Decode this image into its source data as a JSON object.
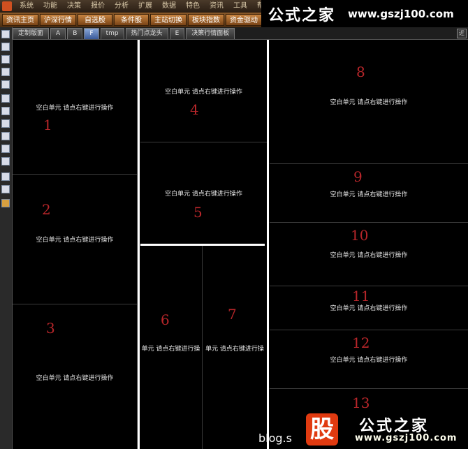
{
  "menubar": {
    "items": [
      "系统",
      "功能",
      "决策",
      "报价",
      "分析",
      "扩展",
      "数据",
      "特色",
      "资讯",
      "工具",
      "帮"
    ]
  },
  "toolbar": {
    "buttons": [
      "资讯主页",
      "沪深行情",
      "自选股",
      "条件股",
      "主站切换",
      "板块指数",
      "资金驱动",
      "资金"
    ]
  },
  "brand": {
    "name": "公式之家",
    "url": "www.gszj100.com"
  },
  "tabs": [
    "定制版面",
    "A",
    "B",
    "F",
    "tmp",
    "热门点龙头",
    "E",
    "决策行情面板"
  ],
  "active_tab": "F",
  "tab_corner": "近",
  "blank_cell_text": "空白单元 请点右键进行操作",
  "cells": [
    {
      "number": "1",
      "text": "空白单元 请点右键进行操作"
    },
    {
      "number": "2",
      "text": "空白单元 请点右键进行操作"
    },
    {
      "number": "3",
      "text": "空白单元 请点右键进行操作"
    },
    {
      "number": "4",
      "text": "空白单元 请点右键进行操作"
    },
    {
      "number": "5",
      "text": "空白单元 请点右键进行操作"
    },
    {
      "number": "6",
      "text": "单元 请点右键进行操"
    },
    {
      "number": "7",
      "text": "单元 请点右键进行操"
    },
    {
      "number": "8",
      "text": "空白单元 请点右键进行操作"
    },
    {
      "number": "9",
      "text": "空白单元 请点右键进行操作"
    },
    {
      "number": "10",
      "text": "空白单元 请点右键进行操作"
    },
    {
      "number": "11",
      "text": "空白单元 请点右键进行操作"
    },
    {
      "number": "12",
      "text": "空白单元 请点右键进行操作"
    },
    {
      "number": "13",
      "text": ""
    }
  ],
  "watermark": {
    "text": "blog.s",
    "stamp_char": "股",
    "stamp_name": "公式之家",
    "stamp_url": "www.gszj100.com"
  },
  "colors": {
    "background": "#000000",
    "number": "#b8262a",
    "splitter": "#ffffff",
    "grid": "#3c3c3c"
  }
}
